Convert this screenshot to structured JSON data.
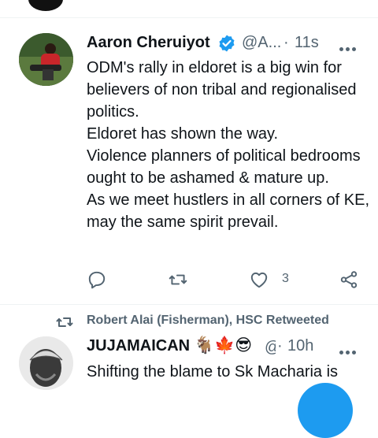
{
  "tweet1": {
    "author_name": "Aaron Cheruiyot",
    "handle": "@A...",
    "separator": "·",
    "time": "11s",
    "body_lines": [
      "ODM's rally in eldoret is a big win for believers of non tribal and regionalised politics.",
      "Eldoret has shown the way.",
      "Violence planners of political bedrooms ought to be ashamed & mature up.",
      "As we meet hustlers in all corners of KE, may the same spirit prevail."
    ],
    "like_count": "3",
    "icons": [
      "reply-icon",
      "retweet-icon",
      "like-icon",
      "share-icon",
      "verified-badge-icon",
      "more-icon"
    ]
  },
  "retweet_context": {
    "label": "Robert Alai (Fisherman), HSC Retweeted"
  },
  "tweet2": {
    "author_name": "JUJAMAICAN",
    "emojis": "🐐🍁😎",
    "handle": "@",
    "separator": "·",
    "time": "10h",
    "body_text": "Shifting the  blame to Sk Macharia is"
  },
  "colors": {
    "verified": "#1d9bf0",
    "secondary_text": "#536471",
    "primary_text": "#0f1419",
    "fab": "#1d9bf0"
  }
}
